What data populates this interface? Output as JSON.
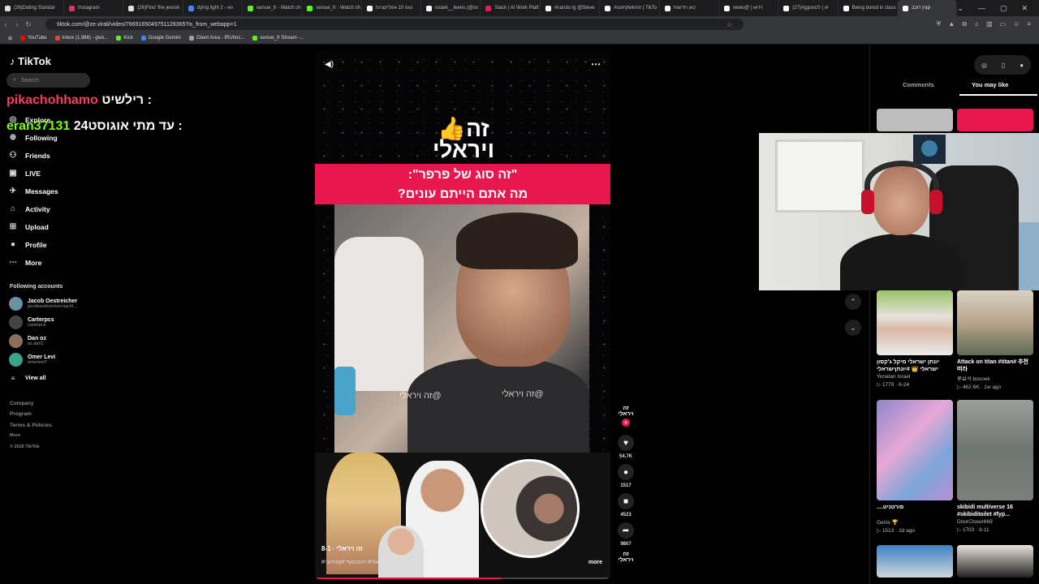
{
  "tabs": [
    {
      "label": "(26)Dating Standar",
      "color": "#e0e0e0"
    },
    {
      "label": "Instagram",
      "color": "#e1306c"
    },
    {
      "label": "(26)Find 'the jewish",
      "color": "#e0e0e0"
    },
    {
      "label": "dying light 2 - ווא",
      "color": "#4285f4"
    },
    {
      "label": "sensei_fr - Watch ch",
      "color": "#53fc18"
    },
    {
      "label": "sensei_fr - Watch ch",
      "color": "#53fc18"
    },
    {
      "label": "טופ 10 אפליקציות",
      "color": "#ffffff"
    },
    {
      "label": "israeli__teens (@isr",
      "color": "#ffffff"
    },
    {
      "label": "Slack | AI Work Platf",
      "color": "#e01e5a"
    },
    {
      "label": "#naruto ig @Steve",
      "color": "#ffffff"
    },
    {
      "label": "#sorrytwinnn | TikTo",
      "color": "#ffffff"
    },
    {
      "label": "כאן חדשות",
      "color": "#ffffff"
    },
    {
      "label": "news@ | וידאו",
      "color": "#ffffff"
    },
    {
      "label": "(27)#ggו | לטופו#",
      "color": "#ffffff"
    },
    {
      "label": "Being bored in class",
      "color": "#ffffff"
    },
    {
      "label": "קצין רוכב",
      "color": "#ffffff",
      "active": true
    }
  ],
  "window_controls": [
    "⌄",
    "—",
    "▢",
    "✕"
  ],
  "address": {
    "url": "tiktok.com/@ze.virali/video/7669165049751129365?is_from_webapp=1"
  },
  "bookmarks": [
    {
      "label": "YouTube",
      "color": "#ff0000"
    },
    {
      "label": "Inbox (1,986) - givo...",
      "color": "#ea4335"
    },
    {
      "label": "Kick",
      "color": "#53fc18"
    },
    {
      "label": "Google Gemini",
      "color": "#4285f4"
    },
    {
      "label": "Client Area - IRUhos...",
      "color": "#9aa0a6"
    },
    {
      "label": "sensei_fr Stream -...",
      "color": "#53fc18"
    }
  ],
  "sidebar": {
    "logo": "TikTok",
    "search_placeholder": "Search",
    "nav": [
      {
        "label": "Explore",
        "icon": "compass-icon",
        "glyph": "◎"
      },
      {
        "label": "Following",
        "icon": "following-icon",
        "glyph": "⊕"
      },
      {
        "label": "Friends",
        "icon": "friends-icon",
        "glyph": "⚇"
      },
      {
        "label": "LIVE",
        "icon": "live-icon",
        "glyph": "▣"
      },
      {
        "label": "Messages",
        "icon": "messages-icon",
        "glyph": "✈"
      },
      {
        "label": "Activity",
        "icon": "activity-icon",
        "glyph": "⌂"
      },
      {
        "label": "Upload",
        "icon": "upload-icon",
        "glyph": "⊞"
      },
      {
        "label": "Profile",
        "icon": "profile-icon",
        "glyph": "●"
      },
      {
        "label": "More",
        "icon": "more-icon",
        "glyph": "⋯"
      }
    ],
    "following_title": "Following accounts",
    "accounts": [
      {
        "name": "Jacob Oestreicher",
        "handle": "jacoboestreichercoachl..."
      },
      {
        "name": "Carterpcs",
        "handle": "carterpcs"
      },
      {
        "name": "Dan oz",
        "handle": "oz.dan1"
      },
      {
        "name": "Omer Levi",
        "handle": "omerlevi7"
      }
    ],
    "view_all": "View all",
    "footer": [
      "Company",
      "Program",
      "Terms & Policies",
      "More",
      "© 2026 TikTok"
    ]
  },
  "stream_overlay": {
    "line1_name": "pikachohhamo",
    "line1_text": "רילשיט :",
    "line2_name": "eran37131",
    "line2_text": "עד מתי אוגוסט24 :",
    "line1_color": "#ff3b5c",
    "line2_color": "#7cfc00"
  },
  "video": {
    "logo_line1": "זה👍",
    "logo_line2": "ויראלי",
    "banner_line1": "\"זה סוג של פרפר\":",
    "banner_line2": "מה אתם הייתם עונים?",
    "watermark": "@זה ויראלי",
    "caption_user": "זה ויראלי · 8-1",
    "caption_tags": "#סורים #fyp# והייראלי# הכוכסוף #קווירובי#",
    "more": "more",
    "progress_percent": 63,
    "accent": "#e8174e"
  },
  "actions": [
    {
      "name": "like",
      "icon": "heart-icon",
      "glyph": "♥",
      "count": "54.7K"
    },
    {
      "name": "comment",
      "icon": "comment-icon",
      "glyph": "●",
      "count": "1517"
    },
    {
      "name": "save",
      "icon": "bookmark-icon",
      "glyph": "■",
      "count": "4523"
    },
    {
      "name": "share",
      "icon": "share-icon",
      "glyph": "➦",
      "count": "9807"
    }
  ],
  "creator_avatar": {
    "line1": "זה",
    "line2": "ויראלי"
  },
  "right_panel": {
    "tab_comments": "Comments",
    "tab_you_may_like": "You may like",
    "cards": [
      {
        "title": "יונתן ישראלי מיקל ג'קסון ישראלי 👑 #יונתןישראלי",
        "author": "Yonatan Israel",
        "views": "1779",
        "date": "6-24"
      },
      {
        "title": "Attack on titan #titan# 추천떠라",
        "author": "루보석 bosoek",
        "views": "462.6K",
        "date": "1w ago"
      },
      {
        "title": "....פורטניט",
        "author": "Genix 🏆",
        "views": "1513",
        "date": "2d ago"
      },
      {
        "title": "skibidi multiverse 16 #skibiditoilet #fyp...",
        "author": "DoorCloser668",
        "views": "1703",
        "date": "8-11"
      }
    ]
  }
}
